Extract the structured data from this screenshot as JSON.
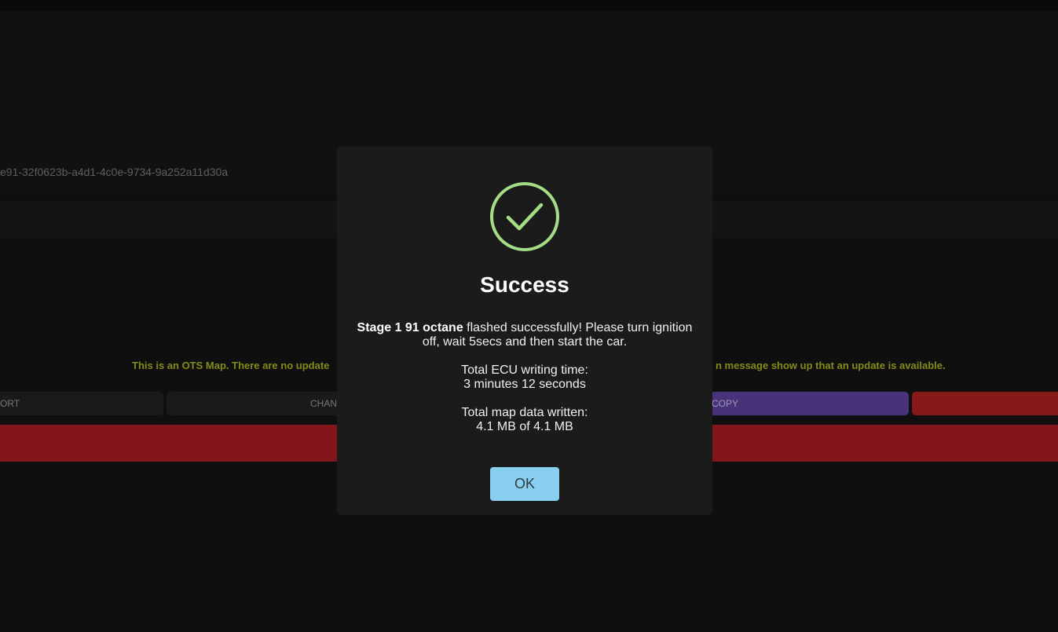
{
  "background": {
    "map_id_text": "e91-32f0623b-a4d1-4c0e-9734-9a252a11d30a",
    "notice_left": "This is an OTS Map. There are no update",
    "notice_right": "n message show up that an update is available.",
    "buttons": {
      "report_label": "ORT",
      "change_label": "CHAN",
      "copy_label": "COPY",
      "copy_color": "#553d91",
      "delete_color": "#a01e1e"
    },
    "red_bar_color": "#9b1b1f",
    "notice_color": "#9ca41c"
  },
  "modal": {
    "icon": "check-circle-icon",
    "icon_color": "#a5dc86",
    "title": "Success",
    "map_name": "Stage 1 91 octane",
    "flash_message": " flashed successfully! Please turn ignition off, wait 5secs and then start the car.",
    "writing_time_label": "Total ECU writing time:",
    "writing_time_value": "3 minutes 12 seconds",
    "data_written_label": "Total map data written:",
    "data_written_value": "4.1 MB of 4.1 MB",
    "ok_label": "OK",
    "ok_color": "#89cff0"
  }
}
